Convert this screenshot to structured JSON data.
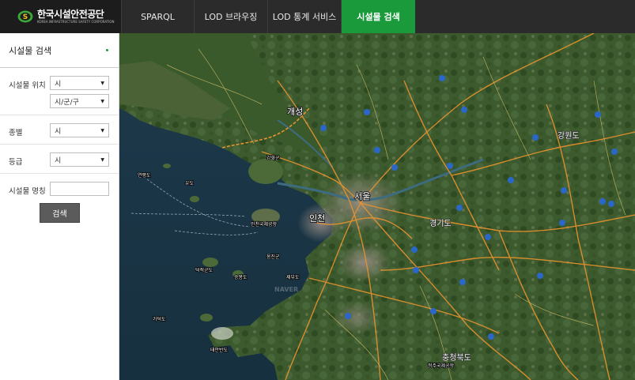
{
  "header": {
    "logo_ko": "한국시설안전공단",
    "logo_en": "KOREA INFRASTRUCTURE SAFETY CORPORATION",
    "tabs": [
      {
        "label": "SPARQL"
      },
      {
        "label": "LOD 브라우징"
      },
      {
        "label": "LOD 통계 서비스"
      },
      {
        "label": "시설물 검색",
        "active": true
      }
    ],
    "active_color": "#1a9a3a"
  },
  "sidebar": {
    "title": "시설물 검색",
    "location_label": "시설물 위치",
    "location_city": "시",
    "location_district": "시/군/구",
    "type_label": "종별",
    "type_value": "시",
    "grade_label": "등급",
    "grade_value": "시",
    "name_label": "시설물 명칭",
    "name_value": "",
    "search_button": "검색"
  },
  "map": {
    "labels": {
      "seoul": "서울",
      "incheon": "인천",
      "gaeseong": "개성",
      "gangwon": "강원도",
      "gyeonggi": "경기도",
      "chungbuk": "충청북도",
      "airport": "인천국제공항",
      "ganghwa": "강화군",
      "ongjin": "옹진군",
      "yeonpyeong": "연평도",
      "udo": "우도",
      "deokjeok": "덕적군도",
      "seungbong": "승봉도",
      "gadeok": "가덕도",
      "taean": "태안반도",
      "jebu": "제부도",
      "naver": "NAVER",
      "cheongju_airport": "청주국제공항"
    }
  }
}
